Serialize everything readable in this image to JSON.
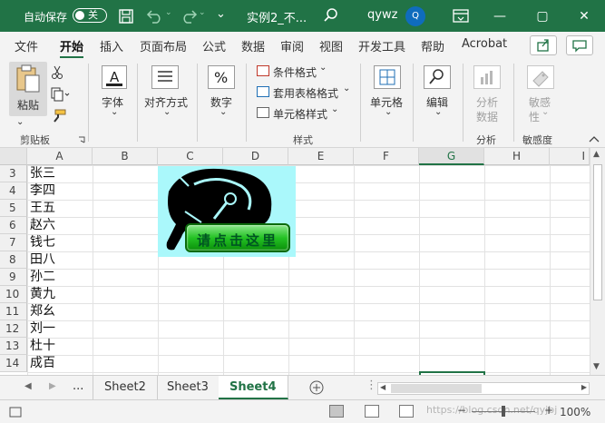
{
  "title_bar": {
    "autosave_label": "自动保存",
    "autosave_state": "关",
    "doc_title": "实例2_不...",
    "user_name": "qywz",
    "avatar_initial": "Q",
    "minimize": "—",
    "restore": "▢",
    "close": "✕"
  },
  "tabs": [
    "文件",
    "开始",
    "插入",
    "页面布局",
    "公式",
    "数据",
    "审阅",
    "视图",
    "开发工具",
    "帮助",
    "Acrobat"
  ],
  "active_tab": "开始",
  "ribbon": {
    "paste_label": "粘贴",
    "clipboard_group": "剪贴板",
    "font_label": "字体",
    "align_label": "对齐方式",
    "number_label": "数字",
    "conditional_format": "条件格式",
    "table_format": "套用表格格式",
    "cell_style": "单元格样式",
    "styles_group": "样式",
    "cells_label": "单元格",
    "edit_label": "编辑",
    "analyze_label": "分析",
    "analyze_label2": "数据",
    "analyze_group": "分析",
    "sensitivity_label": "敏感",
    "sensitivity_label2": "性",
    "sensitivity_group": "敏感度"
  },
  "grid": {
    "columns": [
      "A",
      "B",
      "C",
      "D",
      "E",
      "F",
      "G",
      "H",
      "I"
    ],
    "selected_column": "G",
    "rows": [
      {
        "num": "3",
        "a": "张三"
      },
      {
        "num": "4",
        "a": "李四"
      },
      {
        "num": "5",
        "a": "王五"
      },
      {
        "num": "6",
        "a": "赵六"
      },
      {
        "num": "7",
        "a": "钱七"
      },
      {
        "num": "8",
        "a": "田八"
      },
      {
        "num": "9",
        "a": "孙二"
      },
      {
        "num": "10",
        "a": "黄九"
      },
      {
        "num": "11",
        "a": "郑幺"
      },
      {
        "num": "12",
        "a": "刘一"
      },
      {
        "num": "13",
        "a": "杜十"
      },
      {
        "num": "14",
        "a": "成百"
      }
    ]
  },
  "picture": {
    "button_label": "请点击这里",
    "bg_color": "#aaf8fb",
    "button_color": "#24c224"
  },
  "sheets": {
    "ellipsis": "...",
    "items": [
      "Sheet2",
      "Sheet3",
      "Sheet4"
    ],
    "active": "Sheet4"
  },
  "status": {
    "zoom": "100%",
    "watermark": "https://blog.csdn.net/qyjbj"
  }
}
